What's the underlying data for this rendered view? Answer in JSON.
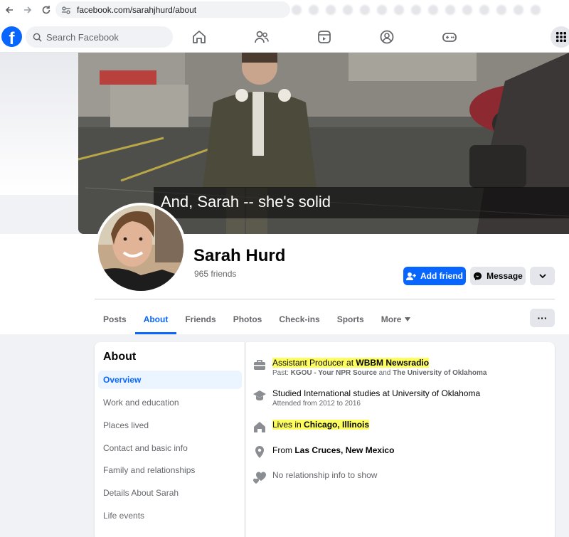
{
  "browser": {
    "url": "facebook.com/sarahjhurd/about"
  },
  "topbar": {
    "logo": "f",
    "search_placeholder": "Search Facebook",
    "icons": [
      "home-icon",
      "friends-icon",
      "video-icon",
      "groups-icon",
      "gaming-icon",
      "menu-grid-icon"
    ]
  },
  "cover": {
    "caption": "And, Sarah -- she's solid"
  },
  "profile": {
    "name": "Sarah Hurd",
    "friends": "965 friends",
    "add_friend": "Add friend",
    "message": "Message",
    "more_dots": "···"
  },
  "tabs": [
    "Posts",
    "About",
    "Friends",
    "Photos",
    "Check-ins",
    "Sports",
    "More"
  ],
  "about": {
    "title": "About",
    "sidebar": [
      "Overview",
      "Work and education",
      "Places lived",
      "Contact and basic info",
      "Family and relationships",
      "Details About Sarah",
      "Life events"
    ],
    "work": {
      "prefix": "Assistant Producer at ",
      "employer": "WBBM Newsradio",
      "past_prefix": "Past: ",
      "past_1": "KGOU - Your NPR Source",
      "past_and": " and ",
      "past_2": "The University of Oklahoma"
    },
    "education": {
      "main": "Studied International studies at University of Oklahoma",
      "sub": "Attended from 2012 to 2016"
    },
    "lives": {
      "prefix": "Lives in ",
      "place": "Chicago, Illinois"
    },
    "from": {
      "prefix": "From ",
      "place": "Las Cruces, New Mexico"
    },
    "relationship": "No relationship info to show"
  },
  "colors": {
    "brand": "#0866ff",
    "highlight": "#fdfd5f"
  }
}
